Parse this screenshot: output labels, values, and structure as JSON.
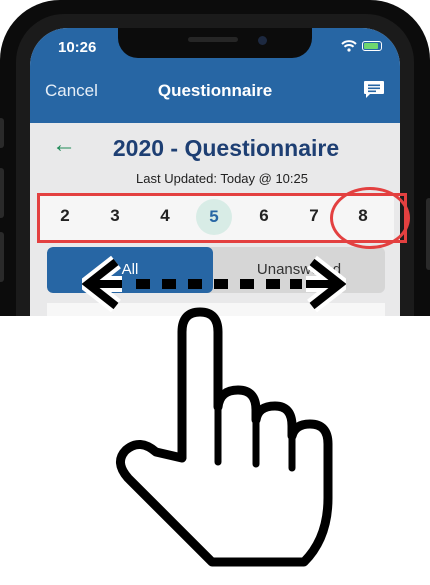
{
  "status": {
    "time": "10:26"
  },
  "nav": {
    "cancel_label": "Cancel",
    "title": "Questionnaire"
  },
  "questionnaire": {
    "title": "2020 - Questionnaire",
    "last_updated": "Last Updated: Today @ 10:25"
  },
  "pager": {
    "pages": [
      "2",
      "3",
      "4",
      "5",
      "6",
      "7",
      "8"
    ],
    "current": "5"
  },
  "filter": {
    "all_label": "All",
    "unanswered_label": "Unanswered"
  },
  "colors": {
    "header_blue": "#2766a4",
    "title_navy": "#1e3f73",
    "back_arrow_green": "#1f8a57",
    "highlight_red": "#e34040",
    "active_page_bg": "#d8ece6"
  },
  "icons": {
    "back": "left-arrow-icon",
    "chat": "chat-bubble-icon",
    "gesture": "pointing-hand-icon",
    "swipe": "double-arrow-icon"
  }
}
